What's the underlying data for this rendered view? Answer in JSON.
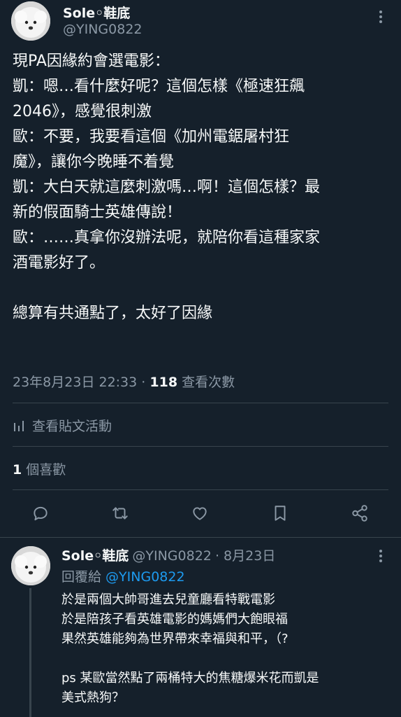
{
  "post": {
    "author_name": "Sole◦鞋底",
    "author_handle": "@YING0822",
    "lines": [
      "現PA因緣約會選電影：",
      "凱：嗯…看什麼好呢？這個怎樣《極速狂飆",
      "2046》，感覺很刺激",
      "歐：不要，我要看這個《加州電鋸屠村狂",
      "魔》，讓你今晚睡不着覺",
      "凱：大白天就這麼刺激嗎…啊！這個怎樣？最",
      "新的假面騎士英雄傳說！",
      "歐：……真拿你沒辦法呢，就陪你看這種家家",
      "酒電影好了。",
      "",
      "總算有共通點了，太好了因緣"
    ],
    "timestamp": "23年8月23日 22:33",
    "separator": " · ",
    "views_count": "118",
    "views_label": " 查看次數",
    "analytics_label": "查看貼文活動",
    "likes_count": "1",
    "likes_label": " 個喜歡"
  },
  "actions": [
    {
      "icon": "reply-icon"
    },
    {
      "icon": "retweet-icon"
    },
    {
      "icon": "like-icon"
    },
    {
      "icon": "bookmark-icon"
    },
    {
      "icon": "share-icon"
    }
  ],
  "reply": {
    "author_name": "Sole◦鞋底",
    "author_handle": "@YING0822",
    "date": "· 8月23日",
    "replying_to_label": "回覆給 ",
    "replying_to_handle": "@YING0822",
    "lines": [
      "於是兩個大帥哥進去兒童廳看特戰電影",
      "於是陪孩子看英雄電影的媽媽們大飽眼福",
      "果然英雄能夠為世界帶來幸福與和平，（?",
      "",
      "ps 某歐當然點了兩桶特大的焦糖爆米花而凱是",
      "美式熱狗？"
    ]
  },
  "colors": {
    "background": "#15202b",
    "text": "#f7f9f9",
    "secondary": "#8b98a5",
    "link": "#1d9bf0",
    "divider": "#38444d"
  }
}
